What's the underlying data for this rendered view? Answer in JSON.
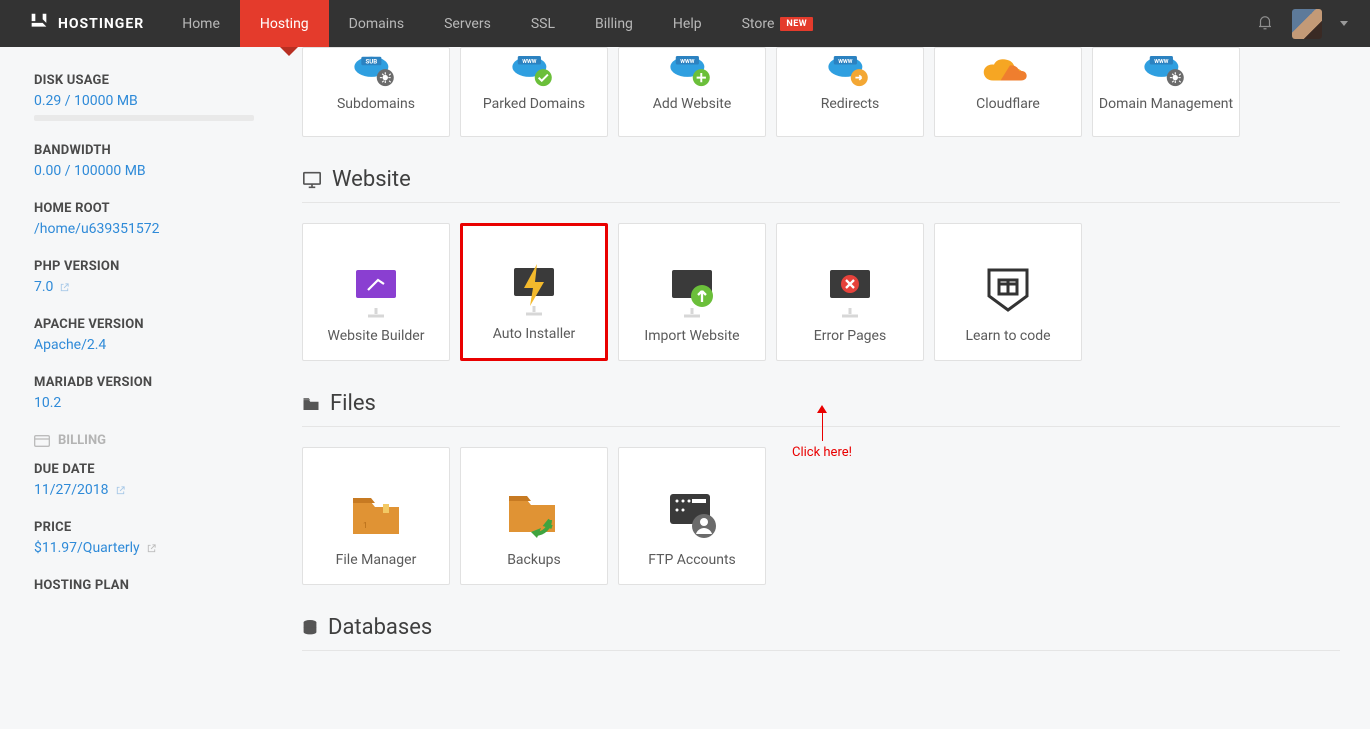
{
  "nav": {
    "brand": "HOSTINGER",
    "items": [
      {
        "label": "Home",
        "active": false
      },
      {
        "label": "Hosting",
        "active": true
      },
      {
        "label": "Domains",
        "active": false
      },
      {
        "label": "Servers",
        "active": false
      },
      {
        "label": "SSL",
        "active": false
      },
      {
        "label": "Billing",
        "active": false
      },
      {
        "label": "Help",
        "active": false
      },
      {
        "label": "Store",
        "active": false,
        "badge": "NEW"
      }
    ]
  },
  "sidebar": {
    "disk_usage": {
      "label": "DISK USAGE",
      "value": "0.29 / 10000 MB"
    },
    "bandwidth": {
      "label": "BANDWIDTH",
      "value": "0.00 / 100000 MB"
    },
    "home_root": {
      "label": "HOME ROOT",
      "value": "/home/u639351572"
    },
    "php": {
      "label": "PHP VERSION",
      "value": "7.0"
    },
    "apache": {
      "label": "APACHE VERSION",
      "value": "Apache/2.4"
    },
    "mariadb": {
      "label": "MARIADB VERSION",
      "value": "10.2"
    },
    "billing_heading": "BILLING",
    "due_date": {
      "label": "DUE DATE",
      "value": "11/27/2018"
    },
    "price": {
      "label": "PRICE",
      "value": "$11.97/Quarterly"
    },
    "hosting_plan": {
      "label": "HOSTING PLAN"
    }
  },
  "sections": {
    "domains_tiles": [
      {
        "label": "Subdomains",
        "icon": "subdomains"
      },
      {
        "label": "Parked Domains",
        "icon": "parked"
      },
      {
        "label": "Add Website",
        "icon": "addsite"
      },
      {
        "label": "Redirects",
        "icon": "redirects"
      },
      {
        "label": "Cloudflare",
        "icon": "cloudflare"
      },
      {
        "label": "Domain Management",
        "icon": "dommgmt"
      }
    ],
    "website": {
      "title": "Website",
      "tiles": [
        {
          "label": "Website Builder",
          "icon": "builder"
        },
        {
          "label": "Auto Installer",
          "icon": "autoinstall",
          "highlight": true
        },
        {
          "label": "Import Website",
          "icon": "import"
        },
        {
          "label": "Error Pages",
          "icon": "errorpages"
        },
        {
          "label": "Learn to code",
          "icon": "learn"
        }
      ]
    },
    "files": {
      "title": "Files",
      "tiles": [
        {
          "label": "File Manager",
          "icon": "filemanager"
        },
        {
          "label": "Backups",
          "icon": "backups"
        },
        {
          "label": "FTP Accounts",
          "icon": "ftp"
        }
      ]
    },
    "databases": {
      "title": "Databases"
    }
  },
  "annotation": "Click here!"
}
